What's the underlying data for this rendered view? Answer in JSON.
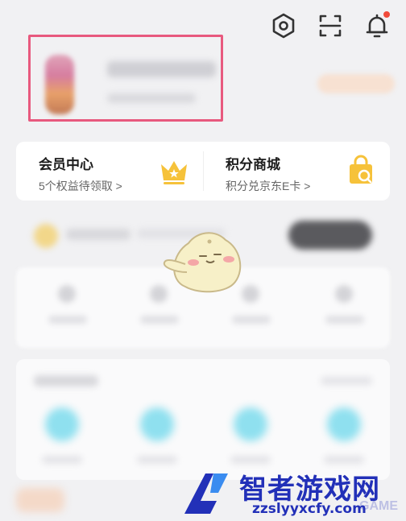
{
  "header": {
    "icons": [
      "settings-icon",
      "scan-icon",
      "bell-icon"
    ],
    "has_notification_dot": true
  },
  "member_center": {
    "title": "会员中心",
    "subtitle": "5个权益待领取 >",
    "icon": "crown-icon"
  },
  "points_mall": {
    "title": "积分商城",
    "subtitle": "积分兑京东E卡 >",
    "icon": "shopping-bag-icon"
  },
  "watermark": {
    "title": "智者游戏网",
    "url": "zzslyyxcfy.com",
    "faint_text": "GAME"
  },
  "colors": {
    "highlight_border": "#e8597e",
    "crown": "#f6c23a",
    "bag": "#f6c23a",
    "watermark": "#2230b8",
    "notification": "#f04a3a"
  }
}
